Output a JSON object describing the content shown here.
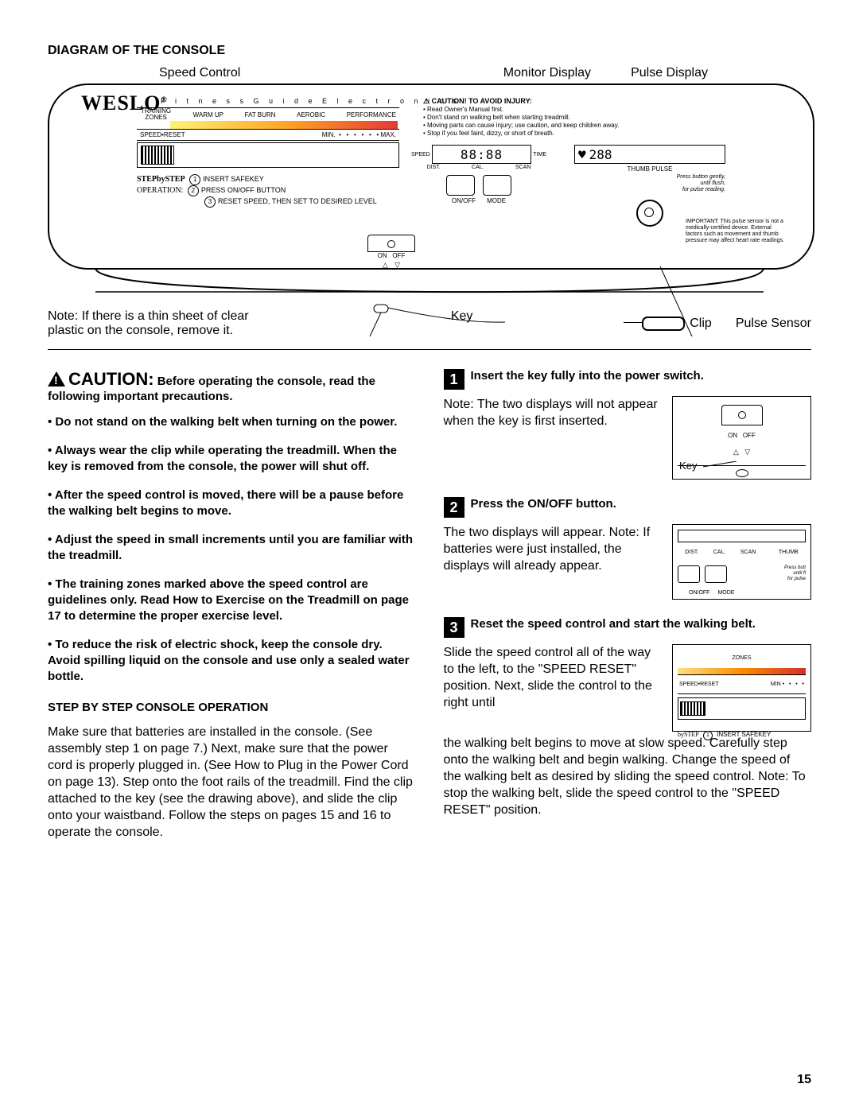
{
  "header": {
    "title": "DIAGRAM OF THE CONSOLE"
  },
  "callouts": {
    "speed_control": "Speed Control",
    "monitor_display": "Monitor Display",
    "pulse_display": "Pulse Display",
    "key": "Key",
    "clip": "Clip",
    "pulse_sensor": "Pulse Sensor"
  },
  "console": {
    "logo": "WESLO",
    "logo_mark": "®",
    "tagline": "F i t n e s s   G u i d e   E l e c t r o n i c s",
    "zones_label_1": "TRAINING",
    "zones_label_2": "ZONES",
    "zone_warmup": "WARM UP",
    "zone_fatburn": "FAT BURN",
    "zone_aerobic": "AEROBIC",
    "zone_performance": "PERFORMANCE",
    "speed_reset": "SPEED•RESET",
    "min": "MIN.",
    "max": "MAX.",
    "step_label": "STEPbySTEP",
    "operation_label": "OPERATION:",
    "step1": "INSERT SAFEKEY",
    "step2": "PRESS ON/OFF BUTTON",
    "step3": "RESET SPEED, THEN SET TO DESIRED LEVEL",
    "caution_head": "⚠ CAUTION! TO AVOID INJURY:",
    "caution_l1": "• Read Owner's Manual first.",
    "caution_l2": "• Don't stand on walking belt when starting treadmill.",
    "caution_l3": "• Moving parts can cause injury; use caution, and keep children away.",
    "caution_l4": "• Stop if you feel faint, dizzy, or short of breath.",
    "speed_lbl": "SPEED",
    "time_lbl": "TIME",
    "dist_lbl": "DIST.",
    "cal_lbl": "CAL.",
    "scan_lbl": "SCAN",
    "onoff_btn": "ON/OFF",
    "mode_btn": "MODE",
    "thumb_pulse": "THUMB PULSE",
    "press_gently_1": "Press button gently,",
    "press_gently_2": "until flush,",
    "press_gently_3": "for pulse reading.",
    "important": "IMPORTANT: This pulse sensor is not a medically-certified device. External factors such as movement and thumb pressure may affect heart rate readings.",
    "on": "ON",
    "off": "OFF",
    "seg_main": "88:88",
    "seg_pulse": "288"
  },
  "note_sheet": "Note: If there is a thin sheet of clear plastic on the console, remove it.",
  "caution_block": {
    "word": "CAUTION:",
    "intro": "Before operating the console, read the following important precautions.",
    "items": [
      "Do not stand on the walking belt when turning on the power.",
      "Always wear the clip while operating the treadmill. When the key is removed from the console, the power will shut off.",
      "After the speed control is moved, there will be a pause before the walking belt begins to move.",
      "Adjust the speed in small increments until you are familiar with the treadmill.",
      "The training zones marked above the speed control are guidelines only. Read How to Exercise on the Treadmill on page 17 to determine the proper exercise level.",
      "To reduce the risk of electric shock, keep the console dry. Avoid spilling liquid on the console and use only a sealed water bottle."
    ]
  },
  "step_section_title": "STEP BY STEP CONSOLE OPERATION",
  "step_intro": "Make sure that batteries are installed in the console. (See assembly step 1 on page 7.) Next, make sure that the power cord is properly plugged in. (See How to Plug in the Power Cord on page 13). Step onto the foot rails of the treadmill. Find the clip attached to the key (see the drawing above), and slide the clip onto your waistband. Follow the steps on pages 15 and 16 to operate the console.",
  "steps": [
    {
      "n": "1",
      "title": "Insert the key fully into the power switch.",
      "body": "Note: The two displays will not appear when the key is first inserted.",
      "fig_key": "Key"
    },
    {
      "n": "2",
      "title": "Press the ON/OFF button.",
      "body": "The two displays will appear. Note: If batteries were just installed, the displays will already appear."
    },
    {
      "n": "3",
      "title": "Reset the speed control and start the walking belt.",
      "body_a": "Slide the speed control all of the way to the left, to the \"SPEED RESET\" position. Next, slide the control to the right until",
      "body_b": "the walking belt begins to move at slow speed. Carefully step onto the walking belt and begin walking. Change the speed of the walking belt as desired by sliding the speed control. Note: To stop the walking belt, slide the speed control to the \"SPEED RESET\" position."
    }
  ],
  "mini2": {
    "dist": "DIST.",
    "cal": "CAL.",
    "scan": "SCAN",
    "thumb": "THUMB",
    "onoff": "ON/OFF",
    "mode": "MODE",
    "hint1": "Press butt",
    "hint2": "until fl",
    "hint3": "for pulse"
  },
  "mini3": {
    "zones": "ZONES",
    "speed_reset": "SPEED•RESET",
    "min": "MIN",
    "bystep": "bySTEP",
    "insert": "INSERT SAFEKEY"
  },
  "page_number": "15"
}
